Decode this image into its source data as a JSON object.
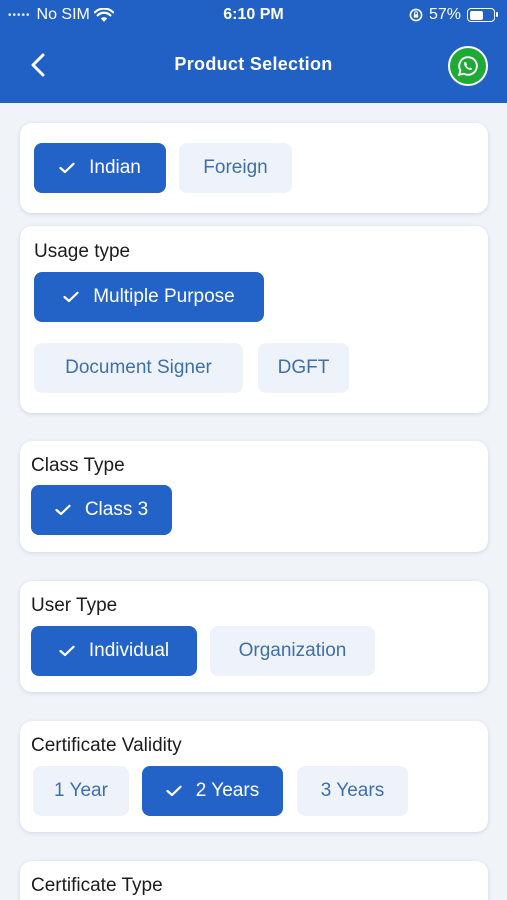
{
  "status": {
    "dots": "•••••",
    "carrier": "No SIM",
    "time": "6:10 PM",
    "battery": "57%",
    "battery_level": 0.57
  },
  "header": {
    "title": "Product Selection"
  },
  "sections": {
    "origin": {
      "options": [
        "Indian",
        "Foreign"
      ]
    },
    "usage": {
      "title": "Usage type",
      "options": [
        "Multiple Purpose",
        "Document Signer",
        "DGFT"
      ]
    },
    "class": {
      "title": "Class Type",
      "options": [
        "Class 3"
      ]
    },
    "user": {
      "title": "User Type",
      "options": [
        "Individual",
        "Organization"
      ]
    },
    "validity": {
      "title": "Certificate Validity",
      "options": [
        "1 Year",
        "2 Years",
        "3 Years"
      ]
    },
    "cert_type": {
      "title": "Certificate Type"
    }
  },
  "colors": {
    "header": "#2160c4",
    "selected": "#2363c8",
    "unselected": "#eef3fb",
    "whatsapp": "#1faa36"
  }
}
